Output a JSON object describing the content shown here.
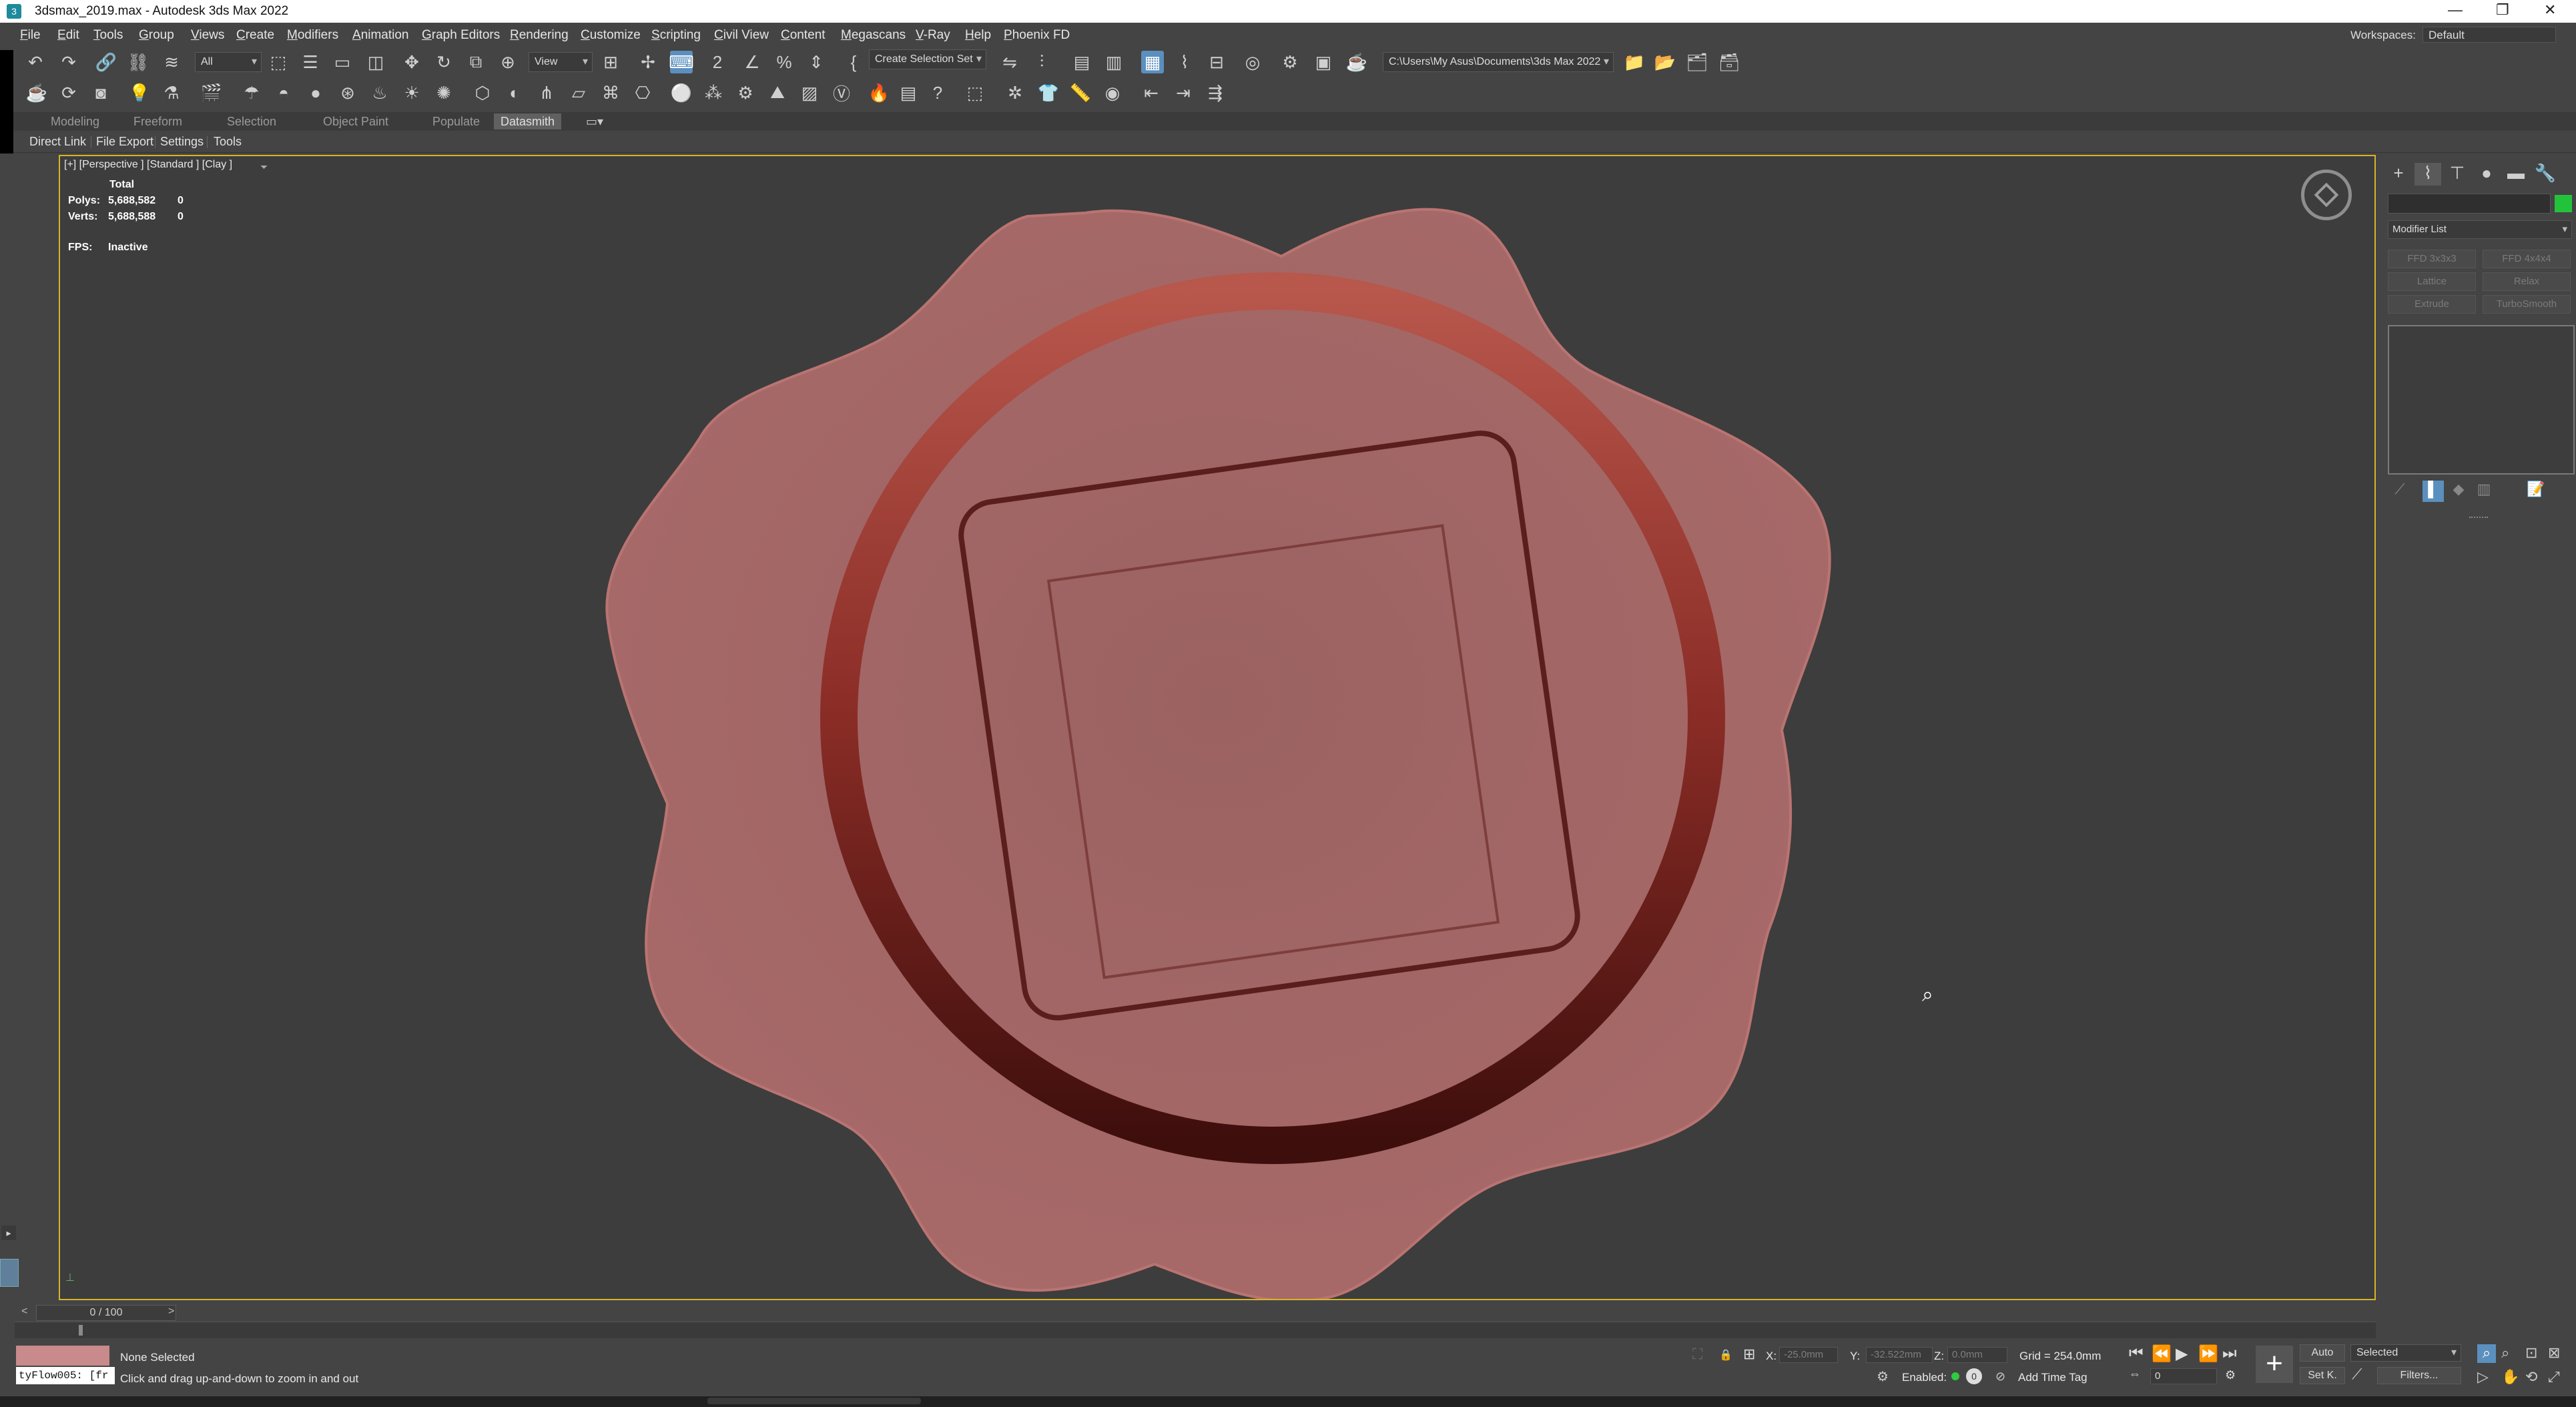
{
  "window": {
    "title": "3dsmax_2019.max - Autodesk 3ds Max 2022",
    "min": "—",
    "restore": "❐",
    "close": "✕"
  },
  "menu": [
    "File",
    "Edit",
    "Tools",
    "Group",
    "Views",
    "Create",
    "Modifiers",
    "Animation",
    "Graph Editors",
    "Rendering",
    "Customize",
    "Scripting",
    "Civil View",
    "Content",
    "Megascans",
    "V-Ray",
    "Help",
    "Phoenix FD"
  ],
  "workspace": {
    "label": "Workspaces:",
    "value": "Default"
  },
  "toolbar": {
    "selection_filter": "All",
    "ref_coord": "View",
    "named_selection": "Create Selection Set",
    "project_path": "C:\\Users\\My Asus\\Documents\\3ds Max 2022"
  },
  "ribbon_tabs": [
    "Modeling",
    "Freeform",
    "Selection",
    "Object Paint",
    "Populate",
    "Datasmith"
  ],
  "datasmith_tabs": [
    "Direct Link",
    "File Export",
    "Settings",
    "Tools"
  ],
  "viewport": {
    "label": "[+] [Perspective ] [Standard ] [Clay ]",
    "stats": {
      "total_label": "Total",
      "polys_label": "Polys:",
      "polys_total": "5,688,582",
      "polys_sel": "0",
      "verts_label": "Verts:",
      "verts_total": "5,688,588",
      "verts_sel": "0",
      "fps_label": "FPS:",
      "fps_value": "Inactive"
    }
  },
  "command_panel": {
    "modifier_list": "Modifier List",
    "buttons": [
      "FFD 3x3x3",
      "FFD 4x4x4",
      "Lattice",
      "Relax",
      "Extrude",
      "TurboSmooth"
    ],
    "object_color": "#22c33b"
  },
  "timeline": {
    "frame": "0 / 100"
  },
  "status": {
    "maxscript": "tyFlow005: [fr",
    "selection": "None Selected",
    "prompt": "Click and drag up-and-down to zoom in and out",
    "x_label": "X:",
    "x_value": "-25.0mm",
    "y_label": "Y:",
    "y_value": "-32.522mm",
    "z_label": "Z:",
    "z_value": "0.0mm",
    "grid": "Grid = 254.0mm",
    "enabled_label": "Enabled:",
    "add_time_tag": "Add Time Tag",
    "auto": "Auto",
    "set_key": "Set K.",
    "selected": "Selected",
    "filters": "Filters...",
    "frame_field": "0"
  },
  "colors": {
    "accent": "#5b8fbe",
    "viewport_border": "#d8b32a",
    "seal": "#a26766",
    "ring_top": "#b8574c",
    "ring_bottom": "#3d0e0c"
  }
}
